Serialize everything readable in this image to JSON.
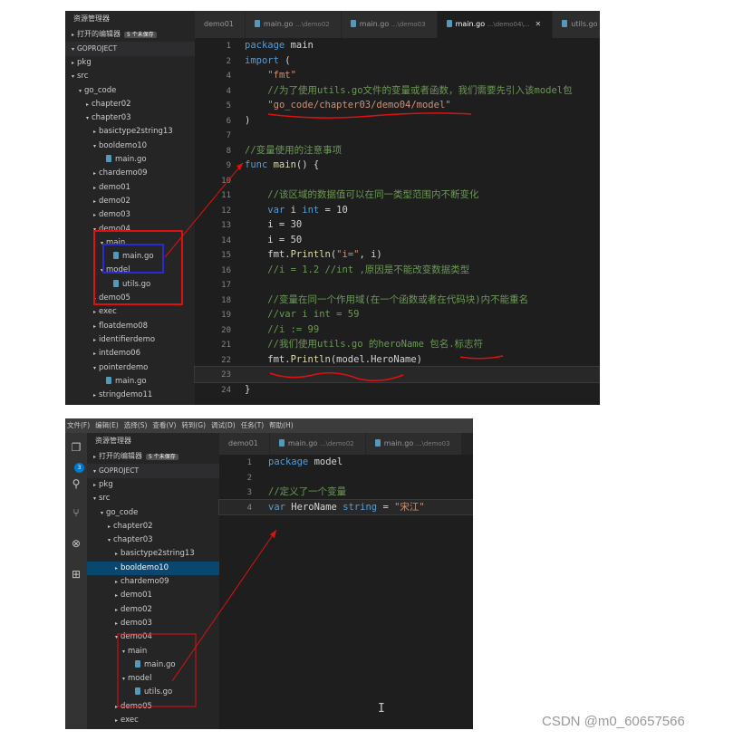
{
  "screenshot1": {
    "sidebar": {
      "title": "资源管理器",
      "open_editors": "打开的编辑器",
      "open_badge": "5 个未保存",
      "project": "GOPROJECT",
      "items": [
        {
          "label": "pkg",
          "depth": 0,
          "arrow": "▸",
          "file": false
        },
        {
          "label": "src",
          "depth": 0,
          "arrow": "▾",
          "file": false
        },
        {
          "label": "go_code",
          "depth": 1,
          "arrow": "▾",
          "file": false
        },
        {
          "label": "chapter02",
          "depth": 2,
          "arrow": "▸",
          "file": false
        },
        {
          "label": "chapter03",
          "depth": 2,
          "arrow": "▾",
          "file": false
        },
        {
          "label": "basictype2string13",
          "depth": 3,
          "arrow": "▸",
          "file": false
        },
        {
          "label": "booldemo10",
          "depth": 3,
          "arrow": "▾",
          "file": false
        },
        {
          "label": "main.go",
          "depth": 4,
          "arrow": "",
          "file": true
        },
        {
          "label": "chardemo09",
          "depth": 3,
          "arrow": "▸",
          "file": false
        },
        {
          "label": "demo01",
          "depth": 3,
          "arrow": "▸",
          "file": false
        },
        {
          "label": "demo02",
          "depth": 3,
          "arrow": "▸",
          "file": false
        },
        {
          "label": "demo03",
          "depth": 3,
          "arrow": "▸",
          "file": false
        },
        {
          "label": "demo04",
          "depth": 3,
          "arrow": "▾",
          "file": false
        },
        {
          "label": "main",
          "depth": 4,
          "arrow": "▾",
          "file": false
        },
        {
          "label": "main.go",
          "depth": 5,
          "arrow": "",
          "file": true
        },
        {
          "label": "model",
          "depth": 4,
          "arrow": "▾",
          "file": false
        },
        {
          "label": "utils.go",
          "depth": 5,
          "arrow": "",
          "file": true
        },
        {
          "label": "demo05",
          "depth": 3,
          "arrow": "▸",
          "file": false
        },
        {
          "label": "exec",
          "depth": 3,
          "arrow": "▸",
          "file": false
        },
        {
          "label": "floatdemo08",
          "depth": 3,
          "arrow": "▸",
          "file": false
        },
        {
          "label": "identifierdemo",
          "depth": 3,
          "arrow": "▸",
          "file": false
        },
        {
          "label": "intdemo06",
          "depth": 3,
          "arrow": "▸",
          "file": false
        },
        {
          "label": "pointerdemo",
          "depth": 3,
          "arrow": "▾",
          "file": false
        },
        {
          "label": "main.go",
          "depth": 4,
          "arrow": "",
          "file": true
        },
        {
          "label": "stringdemo11",
          "depth": 3,
          "arrow": "▸",
          "file": false
        }
      ]
    },
    "tabs": [
      {
        "name": "demo01",
        "path": "",
        "active": false
      },
      {
        "name": "main.go",
        "path": "...\\demo02",
        "active": false
      },
      {
        "name": "main.go",
        "path": "...\\demo03",
        "active": false
      },
      {
        "name": "main.go",
        "path": "...\\demo04\\...",
        "active": true
      },
      {
        "name": "utils.go",
        "path": "",
        "active": false
      }
    ],
    "code": [
      {
        "n": "1",
        "t": [
          [
            "kw",
            "package "
          ],
          [
            "",
            "main"
          ]
        ]
      },
      {
        "n": "2",
        "t": [
          [
            "kw",
            "import "
          ],
          [
            "",
            "("
          ]
        ]
      },
      {
        "n": "4",
        "t": [
          [
            "",
            "    "
          ],
          [
            "str",
            "\"fmt\""
          ]
        ]
      },
      {
        "n": "4",
        "t": [
          [
            "",
            "    "
          ],
          [
            "cm",
            "//为了使用utils.go文件的变量或者函数，我们需要先引入该model包"
          ]
        ]
      },
      {
        "n": "5",
        "t": [
          [
            "",
            "    "
          ],
          [
            "str",
            "\"go_code/chapter03/demo04/model\""
          ]
        ]
      },
      {
        "n": "6",
        "t": [
          [
            "",
            ")"
          ]
        ]
      },
      {
        "n": "7",
        "t": [
          [
            "",
            ""
          ]
        ]
      },
      {
        "n": "8",
        "t": [
          [
            "cm",
            "//变量使用的注意事项"
          ]
        ]
      },
      {
        "n": "9",
        "t": [
          [
            "kw",
            "func "
          ],
          [
            "fn",
            "main"
          ],
          [
            "",
            "() {"
          ]
        ]
      },
      {
        "n": "10",
        "t": [
          [
            "",
            ""
          ]
        ]
      },
      {
        "n": "11",
        "t": [
          [
            "",
            "    "
          ],
          [
            "cm",
            "//该区域的数据值可以在同一类型范围内不断变化"
          ]
        ]
      },
      {
        "n": "12",
        "t": [
          [
            "",
            "    "
          ],
          [
            "kw",
            "var "
          ],
          [
            "",
            "i "
          ],
          [
            "kw",
            "int"
          ],
          [
            "",
            " = 10"
          ]
        ]
      },
      {
        "n": "13",
        "t": [
          [
            "",
            "    i = 30"
          ]
        ]
      },
      {
        "n": "14",
        "t": [
          [
            "",
            "    i = 50"
          ]
        ]
      },
      {
        "n": "15",
        "t": [
          [
            "",
            "    fmt."
          ],
          [
            "fn",
            "Println"
          ],
          [
            "",
            "("
          ],
          [
            "str",
            "\"i=\""
          ],
          [
            "",
            ", i)"
          ]
        ]
      },
      {
        "n": "16",
        "t": [
          [
            "",
            "    "
          ],
          [
            "cm",
            "//i = 1.2 //int ,原因是不能改变数据类型"
          ]
        ]
      },
      {
        "n": "17",
        "t": [
          [
            "",
            ""
          ]
        ]
      },
      {
        "n": "18",
        "t": [
          [
            "",
            "    "
          ],
          [
            "cm",
            "//变量在同一个作用域(在一个函数或者在代码块)内不能重名"
          ]
        ]
      },
      {
        "n": "19",
        "t": [
          [
            "",
            "    "
          ],
          [
            "cm",
            "//var i int = 59"
          ]
        ]
      },
      {
        "n": "20",
        "t": [
          [
            "",
            "    "
          ],
          [
            "cm",
            "//i := 99"
          ]
        ]
      },
      {
        "n": "21",
        "t": [
          [
            "",
            "    "
          ],
          [
            "cm",
            "//我们使用utils.go 的heroName 包名.标志符"
          ]
        ]
      },
      {
        "n": "22",
        "t": [
          [
            "",
            "    fmt."
          ],
          [
            "fn",
            "Println"
          ],
          [
            "",
            "(model.HeroName)"
          ]
        ]
      },
      {
        "n": "23",
        "t": [
          [
            "",
            "    "
          ]
        ],
        "current": true
      },
      {
        "n": "24",
        "t": [
          [
            "",
            "}"
          ]
        ]
      }
    ]
  },
  "screenshot2": {
    "menu": [
      "文件(F)",
      "编辑(E)",
      "选择(S)",
      "查看(V)",
      "转到(G)",
      "调试(D)",
      "任务(T)",
      "帮助(H)"
    ],
    "activity_badge": "3",
    "sidebar": {
      "title": "资源管理器",
      "open_editors": "打开的编辑器",
      "open_badge": "5 个未保存",
      "project": "GOPROJECT",
      "items": [
        {
          "label": "pkg",
          "depth": 0,
          "arrow": "▸",
          "file": false
        },
        {
          "label": "src",
          "depth": 0,
          "arrow": "▾",
          "file": false
        },
        {
          "label": "go_code",
          "depth": 1,
          "arrow": "▾",
          "file": false
        },
        {
          "label": "chapter02",
          "depth": 2,
          "arrow": "▸",
          "file": false
        },
        {
          "label": "chapter03",
          "depth": 2,
          "arrow": "▾",
          "file": false
        },
        {
          "label": "basictype2string13",
          "depth": 3,
          "arrow": "▸",
          "file": false
        },
        {
          "label": "booldemo10",
          "depth": 3,
          "arrow": "▸",
          "file": false,
          "selected": true
        },
        {
          "label": "chardemo09",
          "depth": 3,
          "arrow": "▸",
          "file": false
        },
        {
          "label": "demo01",
          "depth": 3,
          "arrow": "▸",
          "file": false
        },
        {
          "label": "demo02",
          "depth": 3,
          "arrow": "▸",
          "file": false
        },
        {
          "label": "demo03",
          "depth": 3,
          "arrow": "▸",
          "file": false
        },
        {
          "label": "demo04",
          "depth": 3,
          "arrow": "▾",
          "file": false
        },
        {
          "label": "main",
          "depth": 4,
          "arrow": "▾",
          "file": false
        },
        {
          "label": "main.go",
          "depth": 5,
          "arrow": "",
          "file": true
        },
        {
          "label": "model",
          "depth": 4,
          "arrow": "▾",
          "file": false
        },
        {
          "label": "utils.go",
          "depth": 5,
          "arrow": "",
          "file": true
        },
        {
          "label": "demo05",
          "depth": 3,
          "arrow": "▸",
          "file": false
        },
        {
          "label": "exec",
          "depth": 3,
          "arrow": "▸",
          "file": false
        }
      ]
    },
    "tabs": [
      {
        "name": "demo01",
        "path": "",
        "active": false
      },
      {
        "name": "main.go",
        "path": "...\\demo02",
        "active": false
      },
      {
        "name": "main.go",
        "path": "...\\demo03",
        "active": false
      }
    ],
    "code": [
      {
        "n": "1",
        "t": [
          [
            "kw",
            "package "
          ],
          [
            "",
            "model"
          ]
        ]
      },
      {
        "n": "2",
        "t": [
          [
            "",
            ""
          ]
        ]
      },
      {
        "n": "3",
        "t": [
          [
            "cm",
            "//定义了一个变量"
          ]
        ]
      },
      {
        "n": "4",
        "t": [
          [
            "kw",
            "var "
          ],
          [
            "",
            "HeroName "
          ],
          [
            "kw",
            "string"
          ],
          [
            "",
            " = "
          ],
          [
            "str",
            "\"宋江\""
          ]
        ],
        "current": true
      }
    ]
  },
  "watermark": "CSDN @m0_60657566",
  "colors": {
    "annotation": "#e01010",
    "highlight_box": "#2b2bd6"
  }
}
